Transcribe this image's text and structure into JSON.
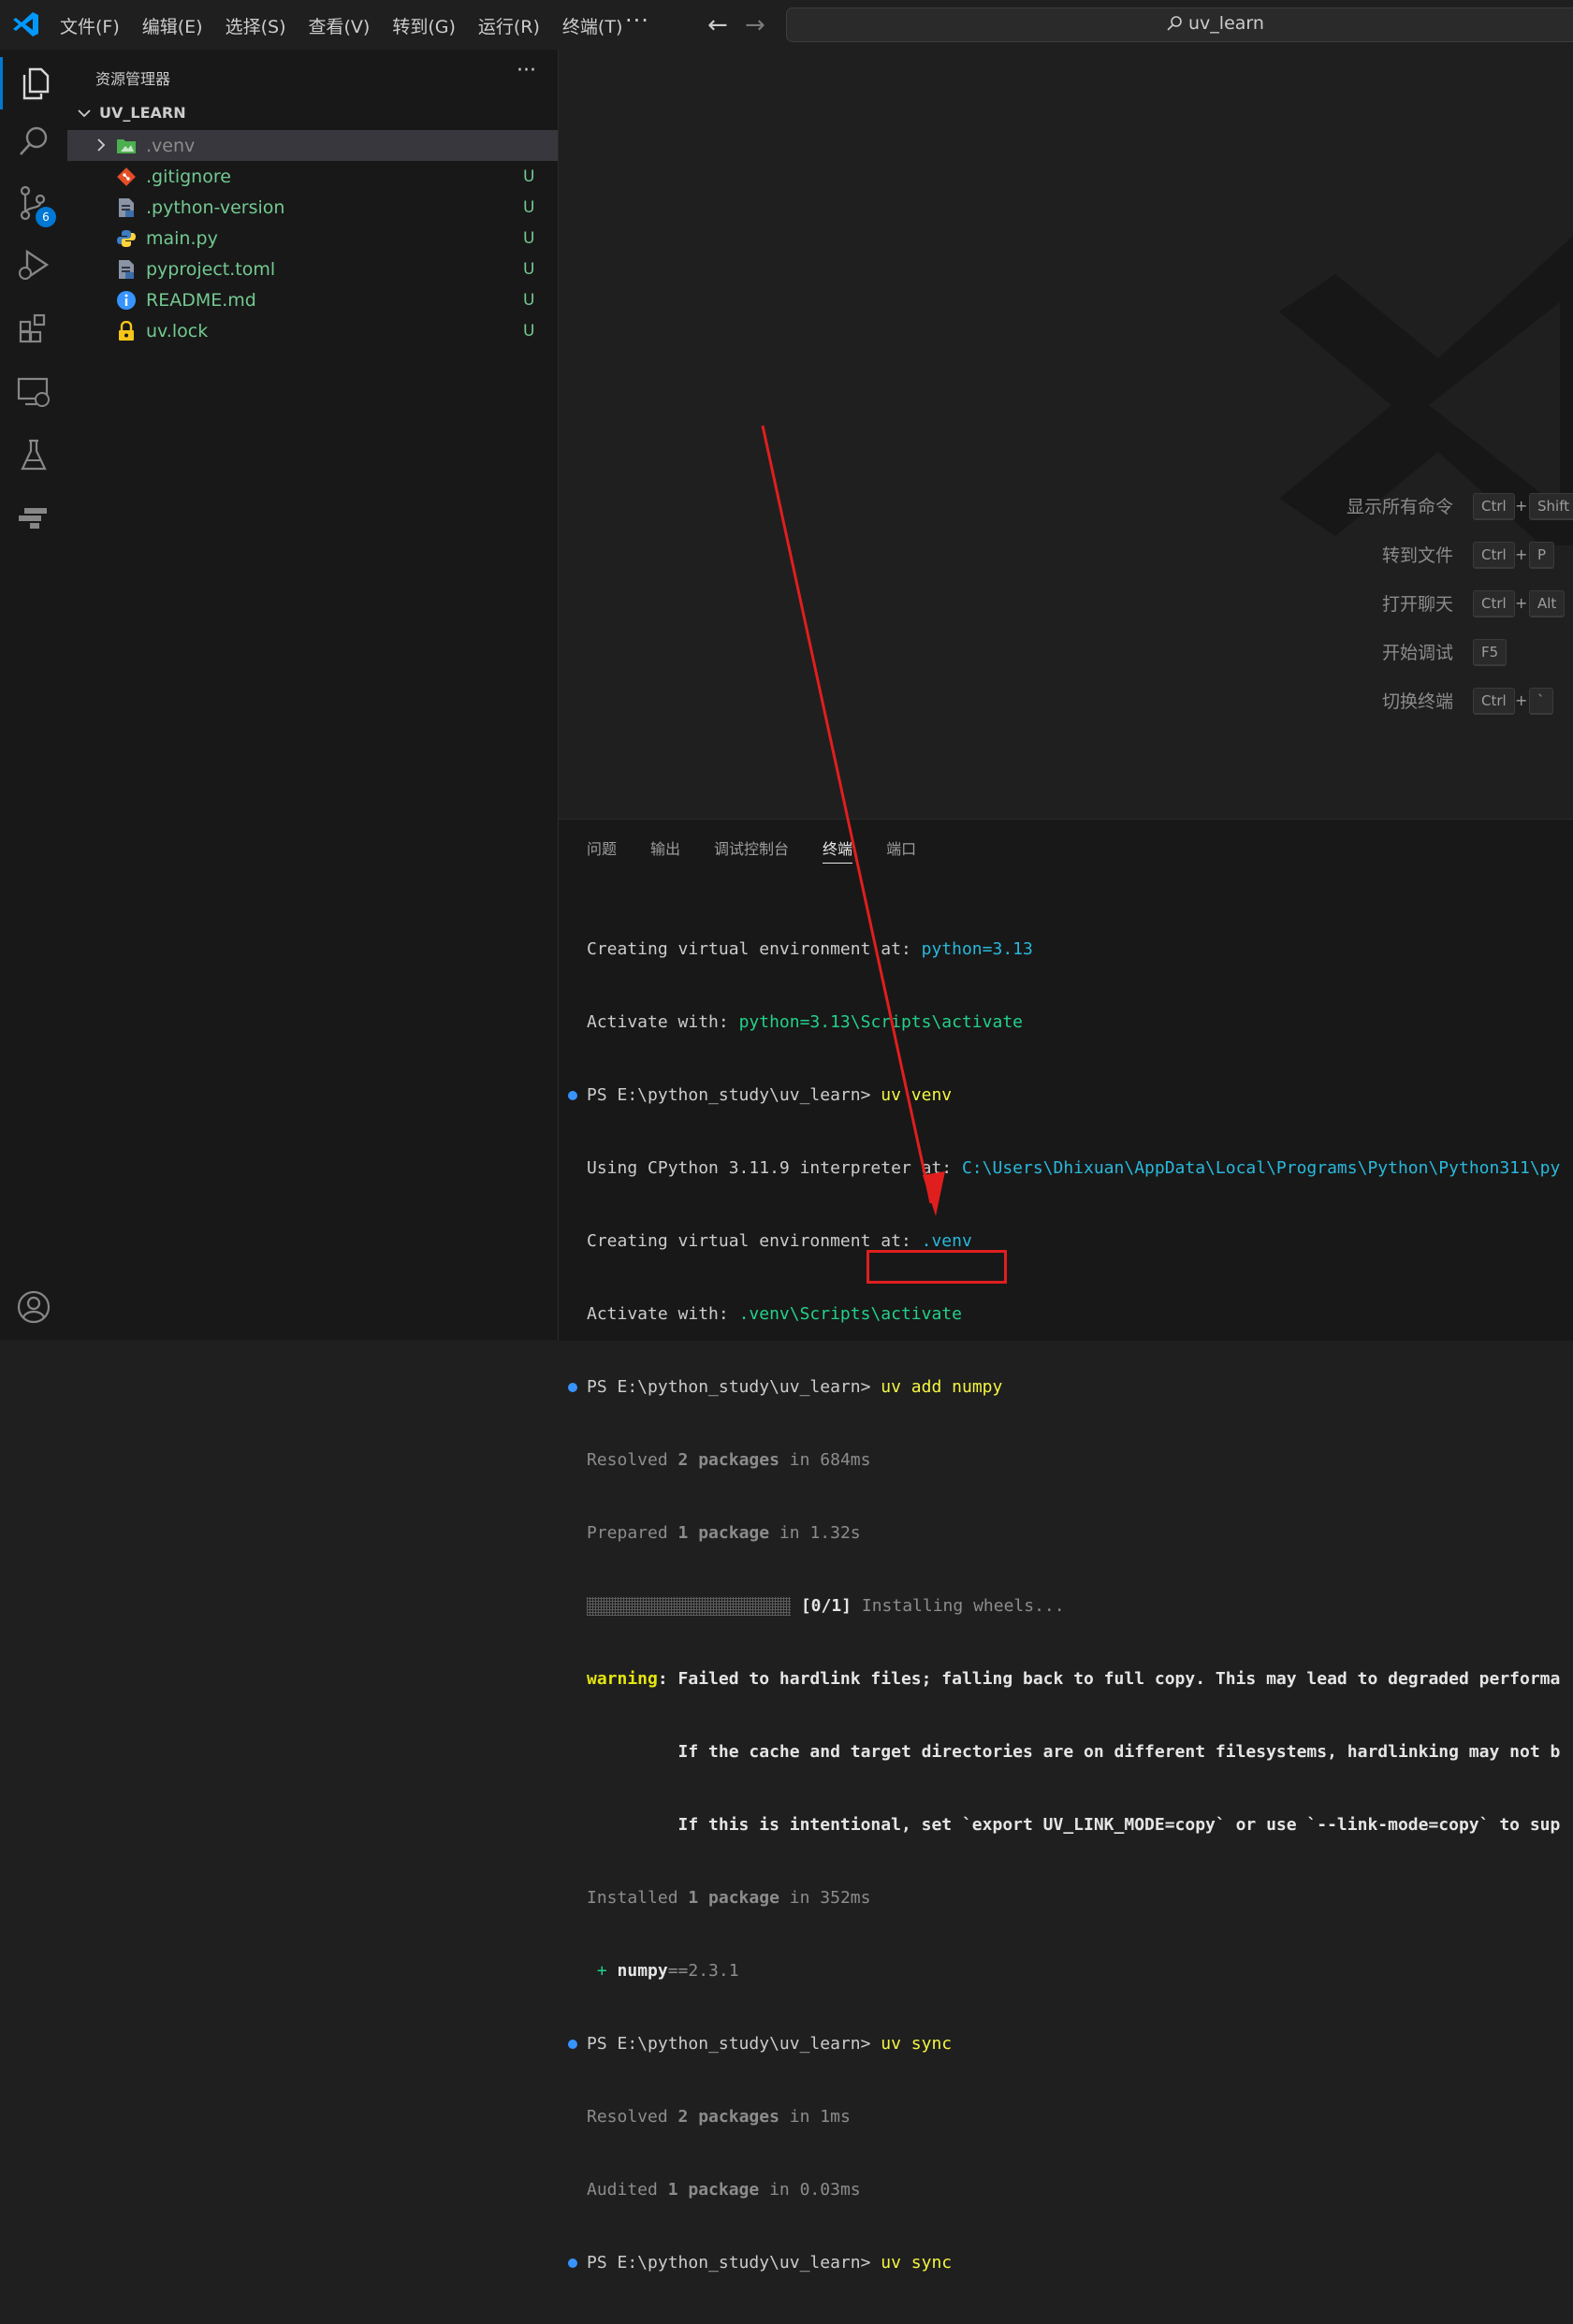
{
  "menu": {
    "items": [
      "文件(F)",
      "编辑(E)",
      "选择(S)",
      "查看(V)",
      "转到(G)",
      "运行(R)",
      "终端(T)"
    ],
    "more": "···"
  },
  "nav": {
    "back": "←",
    "forward": "→"
  },
  "search": {
    "text": "uv_learn"
  },
  "activity": {
    "scm_badge": "6"
  },
  "sidebar": {
    "title": "资源管理器",
    "more": "···",
    "folder": "UV_LEARN",
    "items": [
      {
        "name": ".venv",
        "status": "",
        "icon": "folder-icon"
      },
      {
        "name": ".gitignore",
        "status": "U",
        "icon": "git-icon"
      },
      {
        "name": ".python-version",
        "status": "U",
        "icon": "config-file-icon"
      },
      {
        "name": "main.py",
        "status": "U",
        "icon": "python-icon"
      },
      {
        "name": "pyproject.toml",
        "status": "U",
        "icon": "config-file-icon"
      },
      {
        "name": "README.md",
        "status": "U",
        "icon": "info-icon"
      },
      {
        "name": "uv.lock",
        "status": "U",
        "icon": "lock-icon"
      }
    ]
  },
  "shortcuts": [
    {
      "label": "显示所有命令",
      "keys": [
        "Ctrl",
        "Shift"
      ]
    },
    {
      "label": "转到文件",
      "keys": [
        "Ctrl",
        "P"
      ]
    },
    {
      "label": "打开聊天",
      "keys": [
        "Ctrl",
        "Alt"
      ]
    },
    {
      "label": "开始调试",
      "keys": [
        "F5"
      ]
    },
    {
      "label": "切换终端",
      "keys": [
        "Ctrl",
        "`"
      ]
    }
  ],
  "panel": {
    "tabs": [
      "问题",
      "输出",
      "调试控制台",
      "终端",
      "端口"
    ],
    "active_tab": "终端"
  },
  "terminal": {
    "l1a": "Creating virtual environment at: ",
    "l1b": "python=3.13",
    "l2a": "Activate with: ",
    "l2b": "python=3.13\\Scripts\\activate",
    "prompt": "PS E:\\python_study\\uv_learn> ",
    "cmd_venv": "uv venv",
    "l4a": "Using CPython 3.11.9 interpreter at: ",
    "l4b": "C:\\Users\\Dhixuan\\AppData\\Local\\Programs\\Python\\Python311\\py",
    "l5a": "Creating virtual environment at: ",
    "l5b": ".venv",
    "l6a": "Activate with: ",
    "l6b": ".venv\\Scripts\\activate",
    "cmd_add": "uv add numpy",
    "l8a": "Resolved ",
    "l8b": "2 packages",
    "l8c": " in 684ms",
    "l9a": "Prepared ",
    "l9b": "1 package",
    "l9c": " in 1.32s",
    "l10a": " [0/1] ",
    "l10b": "Installing wheels...",
    "warn_label": "warning",
    "warn1": ": Failed to hardlink files; falling back to full copy. This may lead to degraded performa",
    "warn2": "         If the cache and target directories are on different filesystems, hardlinking may not b",
    "warn3": "         If this is intentional, set `export UV_LINK_MODE=copy` or use `--link-mode=copy` to sup",
    "l14a": "Installed ",
    "l14b": "1 package",
    "l14c": " in 352ms",
    "l15a": " + ",
    "l15b": "numpy",
    "l15c": "==2.3.1",
    "cmd_sync": "uv sync",
    "l17a": "Resolved ",
    "l17b": "2 packages",
    "l17c": " in 1ms",
    "l18a": "Audited ",
    "l18b": "1 package",
    "l18c": " in 0.03ms",
    "cmd_sync2": "uv sync"
  },
  "colors": {
    "accent": "#0078d4",
    "untracked": "#73c991",
    "annotation": "#e01e1e"
  }
}
